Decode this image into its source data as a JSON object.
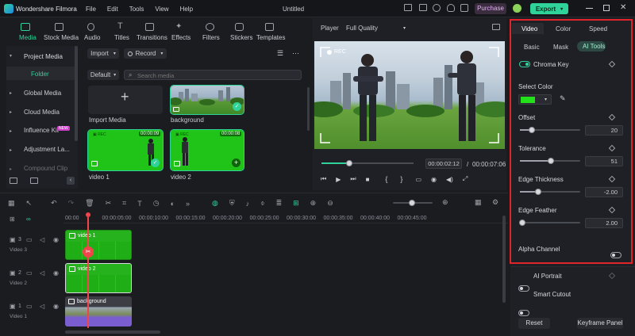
{
  "app": {
    "name": "Wondershare Filmora",
    "project_title": "Untitled",
    "menu": [
      "File",
      "Edit",
      "Tools",
      "View",
      "Help"
    ],
    "purchase_label": "Purchase",
    "export_label": "Export"
  },
  "media_tabs": [
    "Media",
    "Stock Media",
    "Audio",
    "Titles",
    "Transitions",
    "Effects",
    "Filters",
    "Stickers",
    "Templates"
  ],
  "sidebar": {
    "project_media": "Project Media",
    "folder": "Folder",
    "items": [
      "Global Media",
      "Cloud Media",
      "Influence Kit",
      "Adjustment La...",
      "Compound Clip"
    ],
    "new_badge": "NEW"
  },
  "media_toolbar": {
    "import_label": "Import",
    "record_label": "Record",
    "sort_label": "Default",
    "search_placeholder": "Search media"
  },
  "media_items": [
    {
      "label": "Import Media"
    },
    {
      "label": "background"
    },
    {
      "label": "video 1",
      "duration": "00:00:09"
    },
    {
      "label": "video 2",
      "duration": "00:00:08"
    }
  ],
  "player": {
    "label": "Player",
    "quality": "Full Quality",
    "current_time": "00:00:02:12",
    "separator": "/",
    "total_time": "00:00:07:06",
    "rec_label": "REC",
    "progress": 0.3
  },
  "timeline": {
    "ticks": [
      "00:00",
      "00:00:05:00",
      "00:00:10:00",
      "00:00:15:00",
      "00:00:20:00",
      "00:00:25:00",
      "00:00:30:00",
      "00:00:35:00",
      "00:00:40:00",
      "00:00:45:00"
    ],
    "tracks": [
      {
        "label": "Video 3",
        "index": "3",
        "clip": "video 1"
      },
      {
        "label": "Video 2",
        "index": "2",
        "clip": "video 2"
      },
      {
        "label": "Video 1",
        "index": "1",
        "clip": "background"
      }
    ]
  },
  "properties": {
    "tabs": [
      "Video",
      "Color",
      "Speed"
    ],
    "subtabs": [
      "Basic",
      "Mask",
      "AI Tools"
    ],
    "chroma_key": "Chroma Key",
    "select_color": "Select Color",
    "key_color": "#22e11a",
    "sliders": [
      {
        "label": "Offset",
        "value": "20",
        "level": 0.2
      },
      {
        "label": "Tolerance",
        "value": "51",
        "level": 0.51
      },
      {
        "label": "Edge Thickness",
        "value": "-2.00",
        "level": 0.3
      },
      {
        "label": "Edge Feather",
        "value": "2.00",
        "level": 0.04
      }
    ],
    "alpha_channel": "Alpha Channel",
    "ai_portrait": "AI Portrait",
    "smart_cutout": "Smart Cutout",
    "reset_label": "Reset",
    "keyframe_label": "Keyframe Panel"
  },
  "colors": {
    "accent": "#2fd39a",
    "highlight_box": "#e0242a",
    "playhead": "#f0464b"
  }
}
